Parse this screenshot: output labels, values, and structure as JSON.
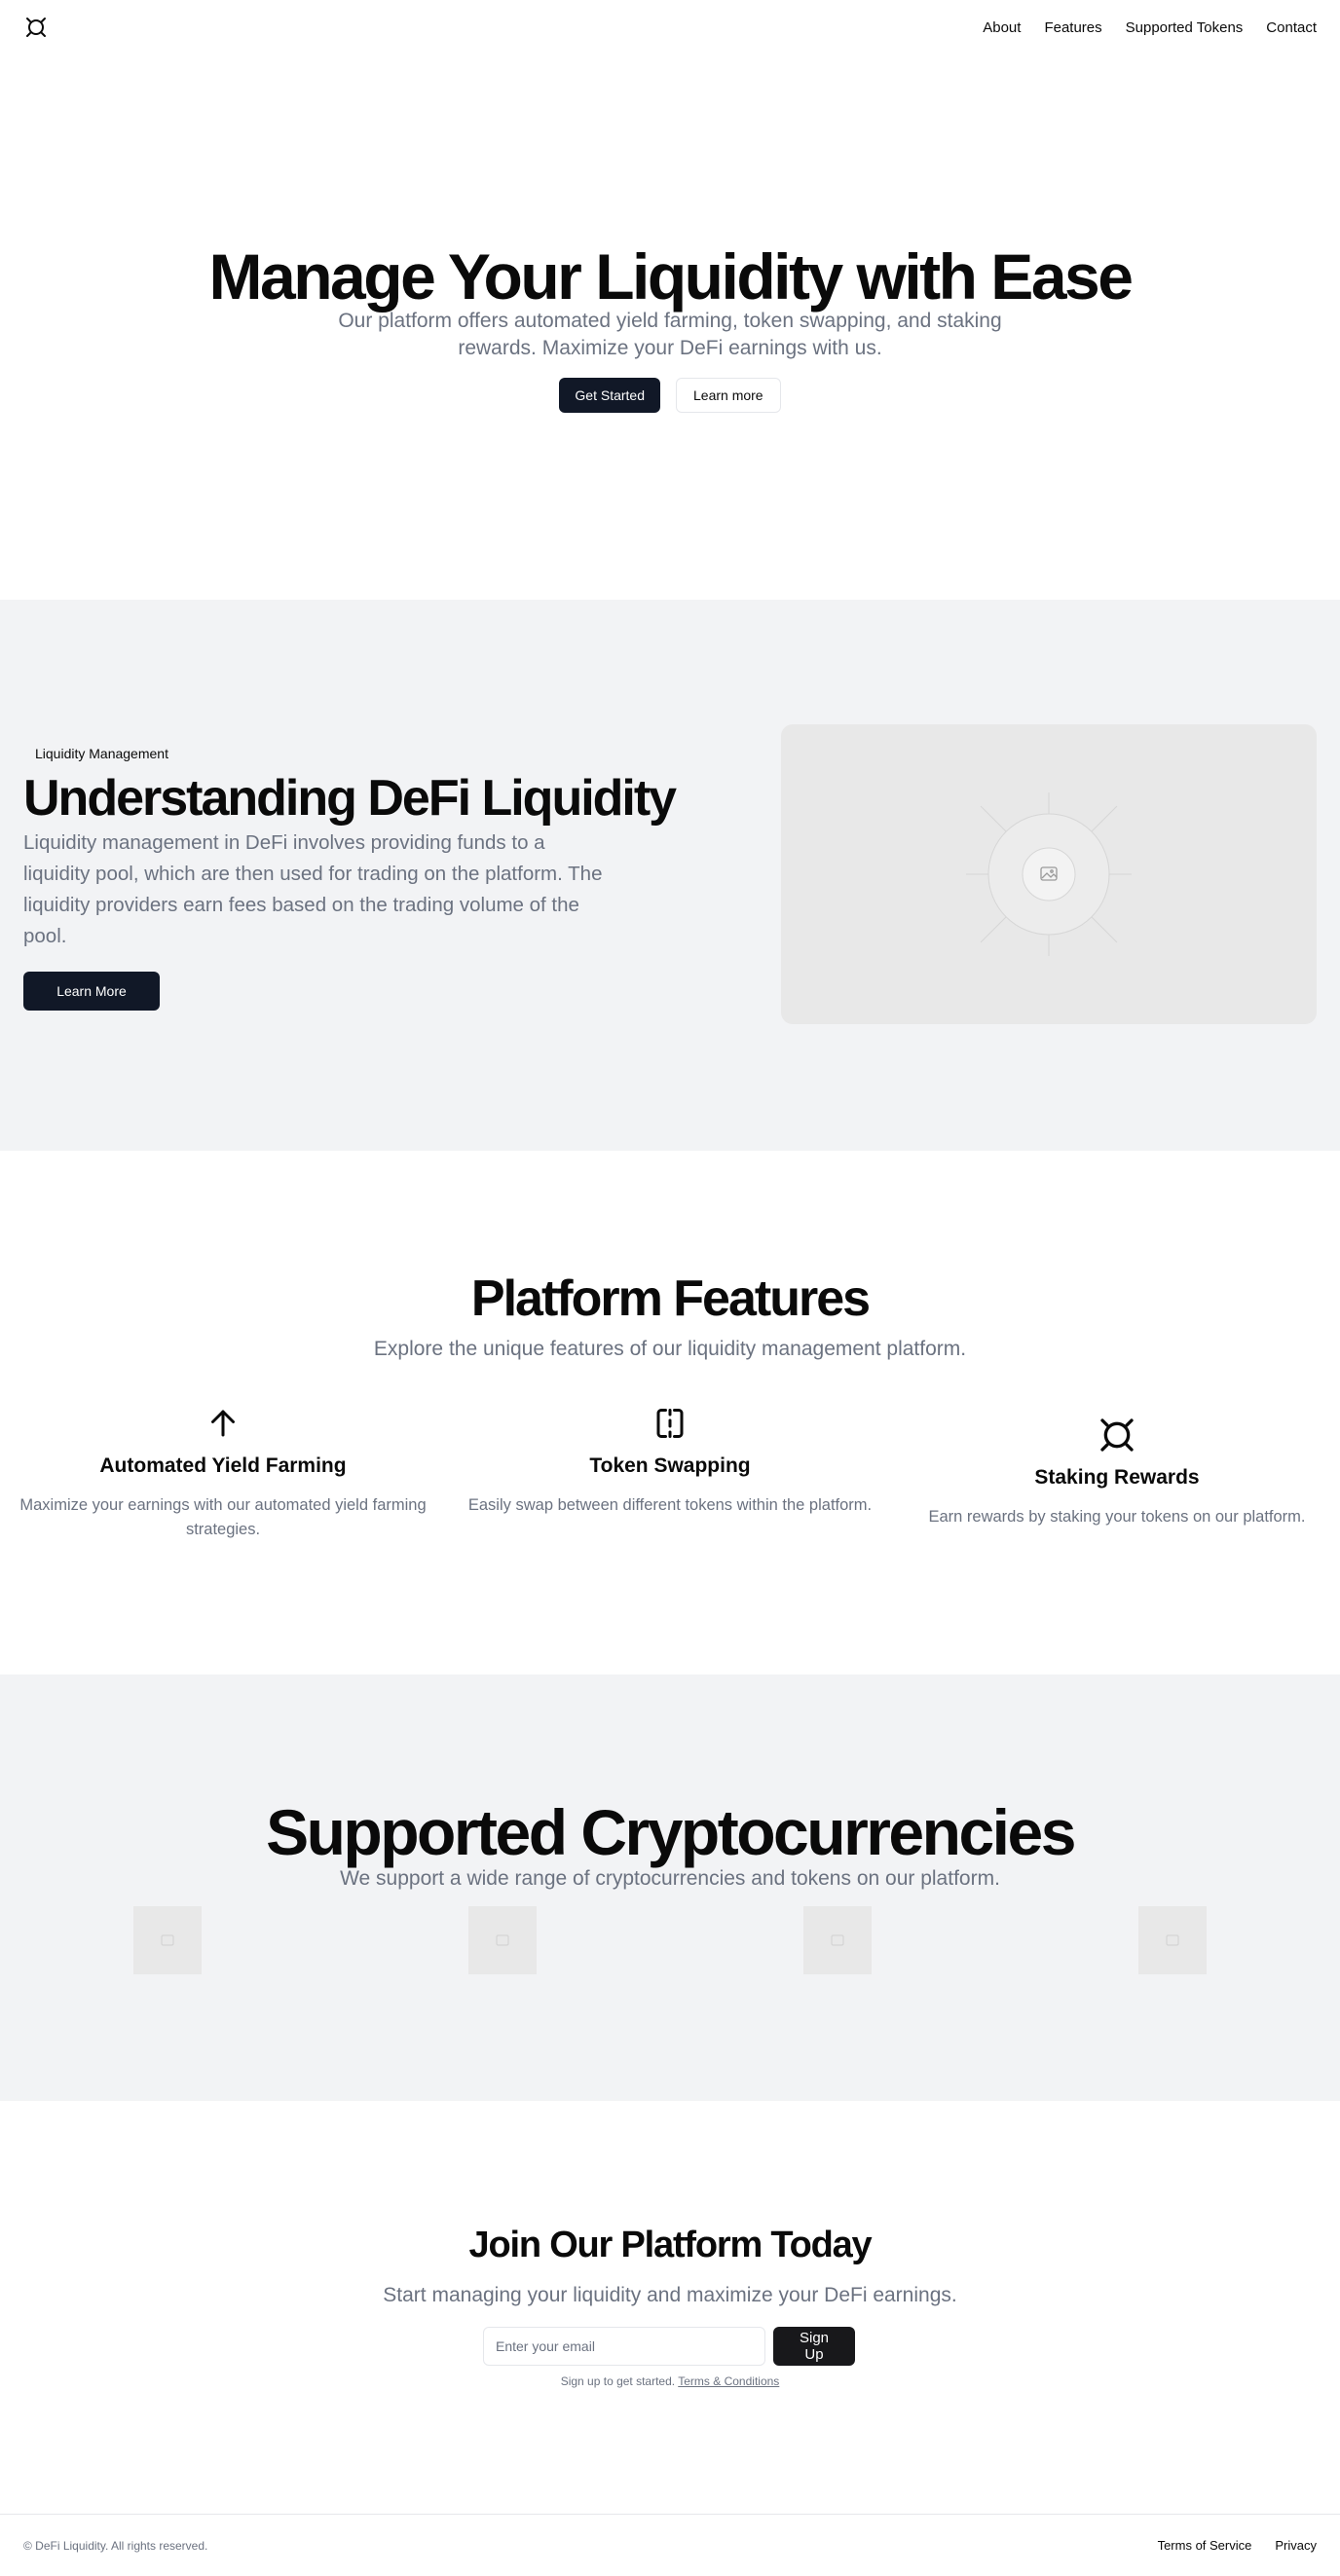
{
  "nav": {
    "logo_icon": "currency-icon",
    "items": [
      {
        "label": "About"
      },
      {
        "label": "Features"
      },
      {
        "label": "Supported Tokens"
      },
      {
        "label": "Contact"
      }
    ]
  },
  "hero": {
    "title": "Manage Your Liquidity with Ease",
    "subtitle": "Our platform offers automated yield farming, token swapping, and staking rewards. Maximize your DeFi earnings with us.",
    "primary_button": "Get Started",
    "secondary_button": "Learn more"
  },
  "liquidity": {
    "badge": "Liquidity Management",
    "title": "Understanding DeFi Liquidity",
    "body": "Liquidity management in DeFi involves providing funds to a liquidity pool, which are then used for trading on the platform. The liquidity providers earn fees based on the trading volume of the pool.",
    "button": "Learn More",
    "image_icon": "image-placeholder-icon"
  },
  "features": {
    "title": "Platform Features",
    "subtitle": "Explore the unique features of our liquidity management platform.",
    "items": [
      {
        "icon": "arrow-up-icon",
        "title": "Automated Yield Farming",
        "description": "Maximize your earnings with our automated yield farming strategies."
      },
      {
        "icon": "swap-icon",
        "title": "Token Swapping",
        "description": "Easily swap between different tokens within the platform."
      },
      {
        "icon": "currency-icon",
        "title": "Staking Rewards",
        "description": "Earn rewards by staking your tokens on our platform."
      }
    ]
  },
  "crypto": {
    "title": "Supported Cryptocurrencies",
    "subtitle": "We support a wide range of cryptocurrencies and tokens on our platform.",
    "token_icon": "image-placeholder-icon"
  },
  "join": {
    "title": "Join Our Platform Today",
    "subtitle": "Start managing your liquidity and maximize your DeFi earnings.",
    "email_placeholder": "Enter your email",
    "button": "Sign Up",
    "fine_print": "Sign up to get started.",
    "terms_link": "Terms & Conditions"
  },
  "footer": {
    "copyright": "© DeFi Liquidity. All rights reserved.",
    "links": [
      {
        "label": "Terms of Service"
      },
      {
        "label": "Privacy"
      }
    ]
  },
  "colors": {
    "primary": "#111827",
    "muted_text": "#6b7280",
    "section_bg": "#f2f3f5",
    "placeholder_bg": "#e8e8e8"
  }
}
